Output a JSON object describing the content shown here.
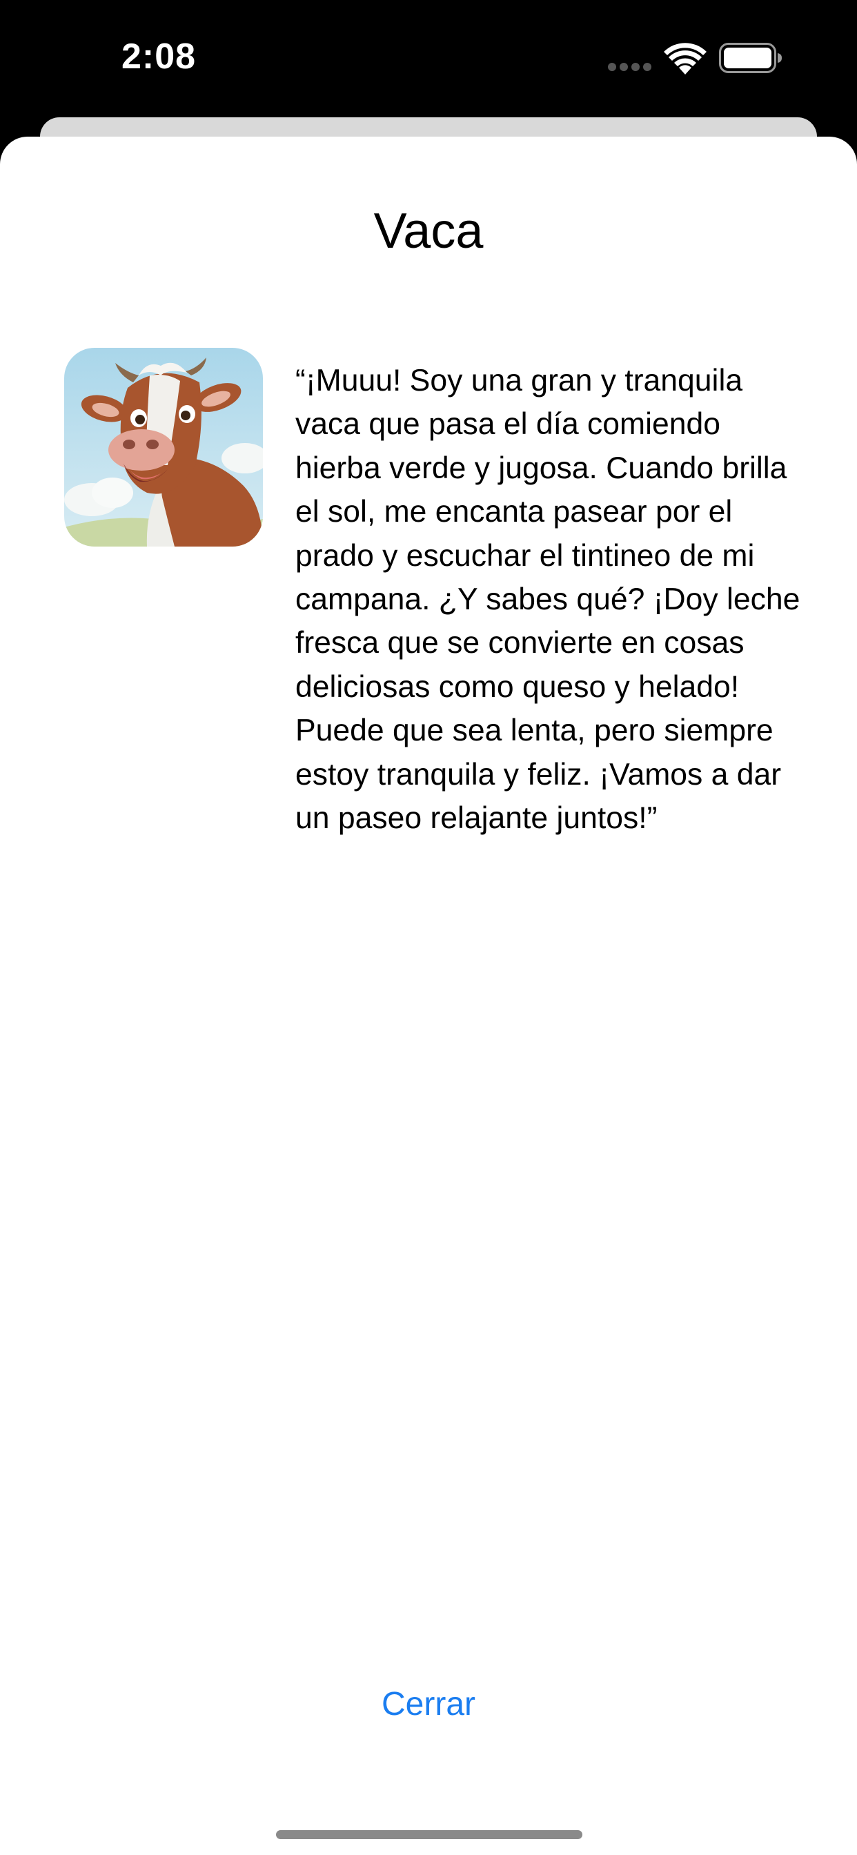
{
  "status_bar": {
    "time": "2:08",
    "signal_icon": "cellular-dots-icon",
    "wifi_icon": "wifi-icon",
    "battery_icon": "battery-icon"
  },
  "sheet": {
    "title": "Vaca",
    "image_icon": "cow-portrait-image",
    "description": "“¡Muuu! Soy una gran y tranquila vaca que pasa el día comiendo hierba verde y jugosa. Cuando brilla el sol, me encanta pasear por el prado y escuchar el tintineo de mi campana. ¿Y sabes qué? ¡Doy leche fresca que se convierte en cosas deliciosas como queso y helado! Puede que sea lenta, pero siempre estoy tranquila y feliz. ¡Vamos a dar un paseo relajante juntos!”",
    "close_label": "Cerrar"
  },
  "colors": {
    "accent": "#1a7df0",
    "status_bar_bg": "#000000",
    "sheet_bg": "#ffffff"
  }
}
